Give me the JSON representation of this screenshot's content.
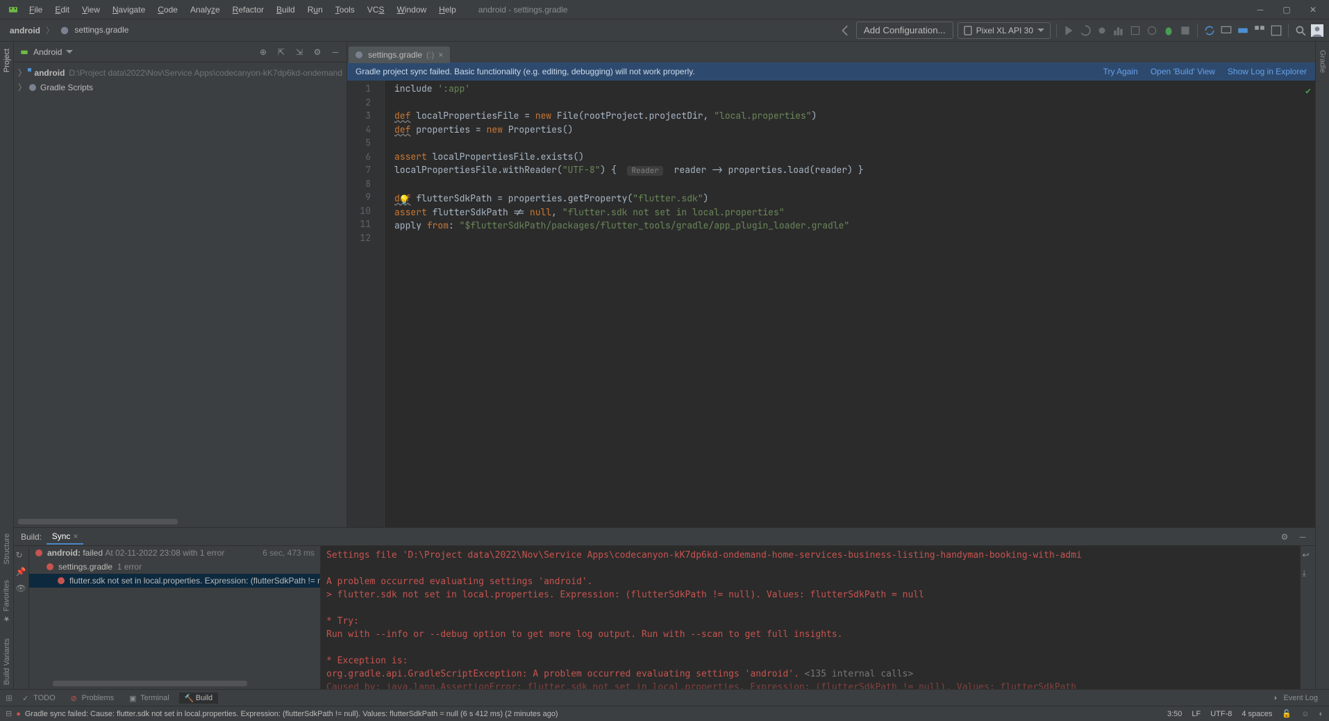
{
  "title": "android - settings.gradle",
  "menu": [
    "File",
    "Edit",
    "View",
    "Navigate",
    "Code",
    "Analyze",
    "Refactor",
    "Build",
    "Run",
    "Tools",
    "VCS",
    "Window",
    "Help"
  ],
  "breadcrumb": {
    "root": "android",
    "file": "settings.gradle"
  },
  "config_btn": "Add Configuration...",
  "device": "Pixel XL API 30",
  "left_tools": {
    "project": "Project"
  },
  "left_tools_lower": [
    "Structure",
    "Favorites",
    "Build Variants"
  ],
  "right_tools": [
    "Gradle"
  ],
  "proj_header": "Android",
  "tree": {
    "mod": "android",
    "mod_path": "D:\\Project data\\2022\\Nov\\Service Apps\\codecanyon-kK7dp6kd-ondemand",
    "scripts": "Gradle Scripts"
  },
  "tab": {
    "name": "settings.gradle",
    "mod": "(:)"
  },
  "banner": {
    "msg": "Gradle project sync failed. Basic functionality (e.g. editing, debugging) will not work properly.",
    "try": "Try Again",
    "open": "Open 'Build' View",
    "show": "Show Log in Explorer"
  },
  "code": {
    "lines": [
      "1",
      "2",
      "3",
      "4",
      "5",
      "6",
      "7",
      "8",
      "9",
      "10",
      "11",
      "12"
    ],
    "l1a": "include ",
    "l1b": "':app'",
    "l3a": "def",
    "l3b": " localPropertiesFile = ",
    "l3c": "new",
    "l3d": " File(rootProject.projectDir, ",
    "l3e": "\"local.properties\"",
    "l3f": ")",
    "l4a": "def",
    "l4b": " properties = ",
    "l4c": "new",
    "l4d": " Properties()",
    "l6a": "assert",
    "l6b": " localPropertiesFile.exists()",
    "l7a": "localPropertiesFile.withReader(",
    "l7b": "\"UTF-8\"",
    "l7c": ") { ",
    "l7p": "Reader",
    "l7d": " reader -> properties.load(reader) }",
    "l9a": "def",
    "l9b": " flutterSdkPath = properties.getProperty(",
    "l9c": "\"flutter.sdk\"",
    "l9d": ")",
    "l10a": "assert",
    "l10b": " flutterSdkPath != ",
    "l10c": "null",
    "l10d": ", ",
    "l10e": "\"flutter.sdk not set in local.properties\"",
    "l11a": "apply ",
    "l11b": "from",
    "l11c": ": ",
    "l11d": "\"",
    "l11e": "$flutterSdkPath",
    "l11f": "/packages/flutter_tools/gradle/app_plugin_loader.gradle",
    "l11g": "\""
  },
  "build": {
    "header_label": "Build:",
    "sync": "Sync",
    "row1a": "android:",
    "row1b": "failed",
    "row1c": "At 02-11-2022 23:08 with 1 error",
    "row1t": "6 sec, 473 ms",
    "row2": "settings.gradle",
    "row2c": "1 error",
    "row3": "flutter.sdk not set in local.properties. Expression: (flutterSdkPath != null). '",
    "out1": "Settings file 'D:\\Project data\\2022\\Nov\\Service Apps\\codecanyon-kK7dp6kd-ondemand-home-services-business-listing-handyman-booking-with-admi",
    "out2": "A problem occurred evaluating settings 'android'.",
    "out3": "> flutter.sdk not set in local.properties. Expression: (flutterSdkPath != null). Values: flutterSdkPath = null",
    "out4": "* Try:",
    "out5": "Run with --info or --debug option to get more log output. Run with --scan to get full insights.",
    "out6": "* Exception is:",
    "out7a": "org.gradle.api.GradleScriptException: A problem occurred evaluating settings 'android'.",
    "out7b": " <135 internal calls>",
    "out8": "Caused by: java.lang.AssertionError: flutter.sdk not set in local.properties. Expression: (flutterSdkPath != null). Values: flutterSdkPath"
  },
  "bottom_tabs": {
    "todo": "TODO",
    "problems": "Problems",
    "terminal": "Terminal",
    "build": "Build"
  },
  "event_log": "Event Log",
  "status": {
    "msg": "Gradle sync failed: Cause: flutter.sdk not set in local.properties. Expression: (flutterSdkPath != null). Values: flutterSdkPath = null (6 s 412 ms) (2 minutes ago)",
    "pos": "3:50",
    "le": "LF",
    "enc": "UTF-8",
    "indent": "4 spaces"
  }
}
